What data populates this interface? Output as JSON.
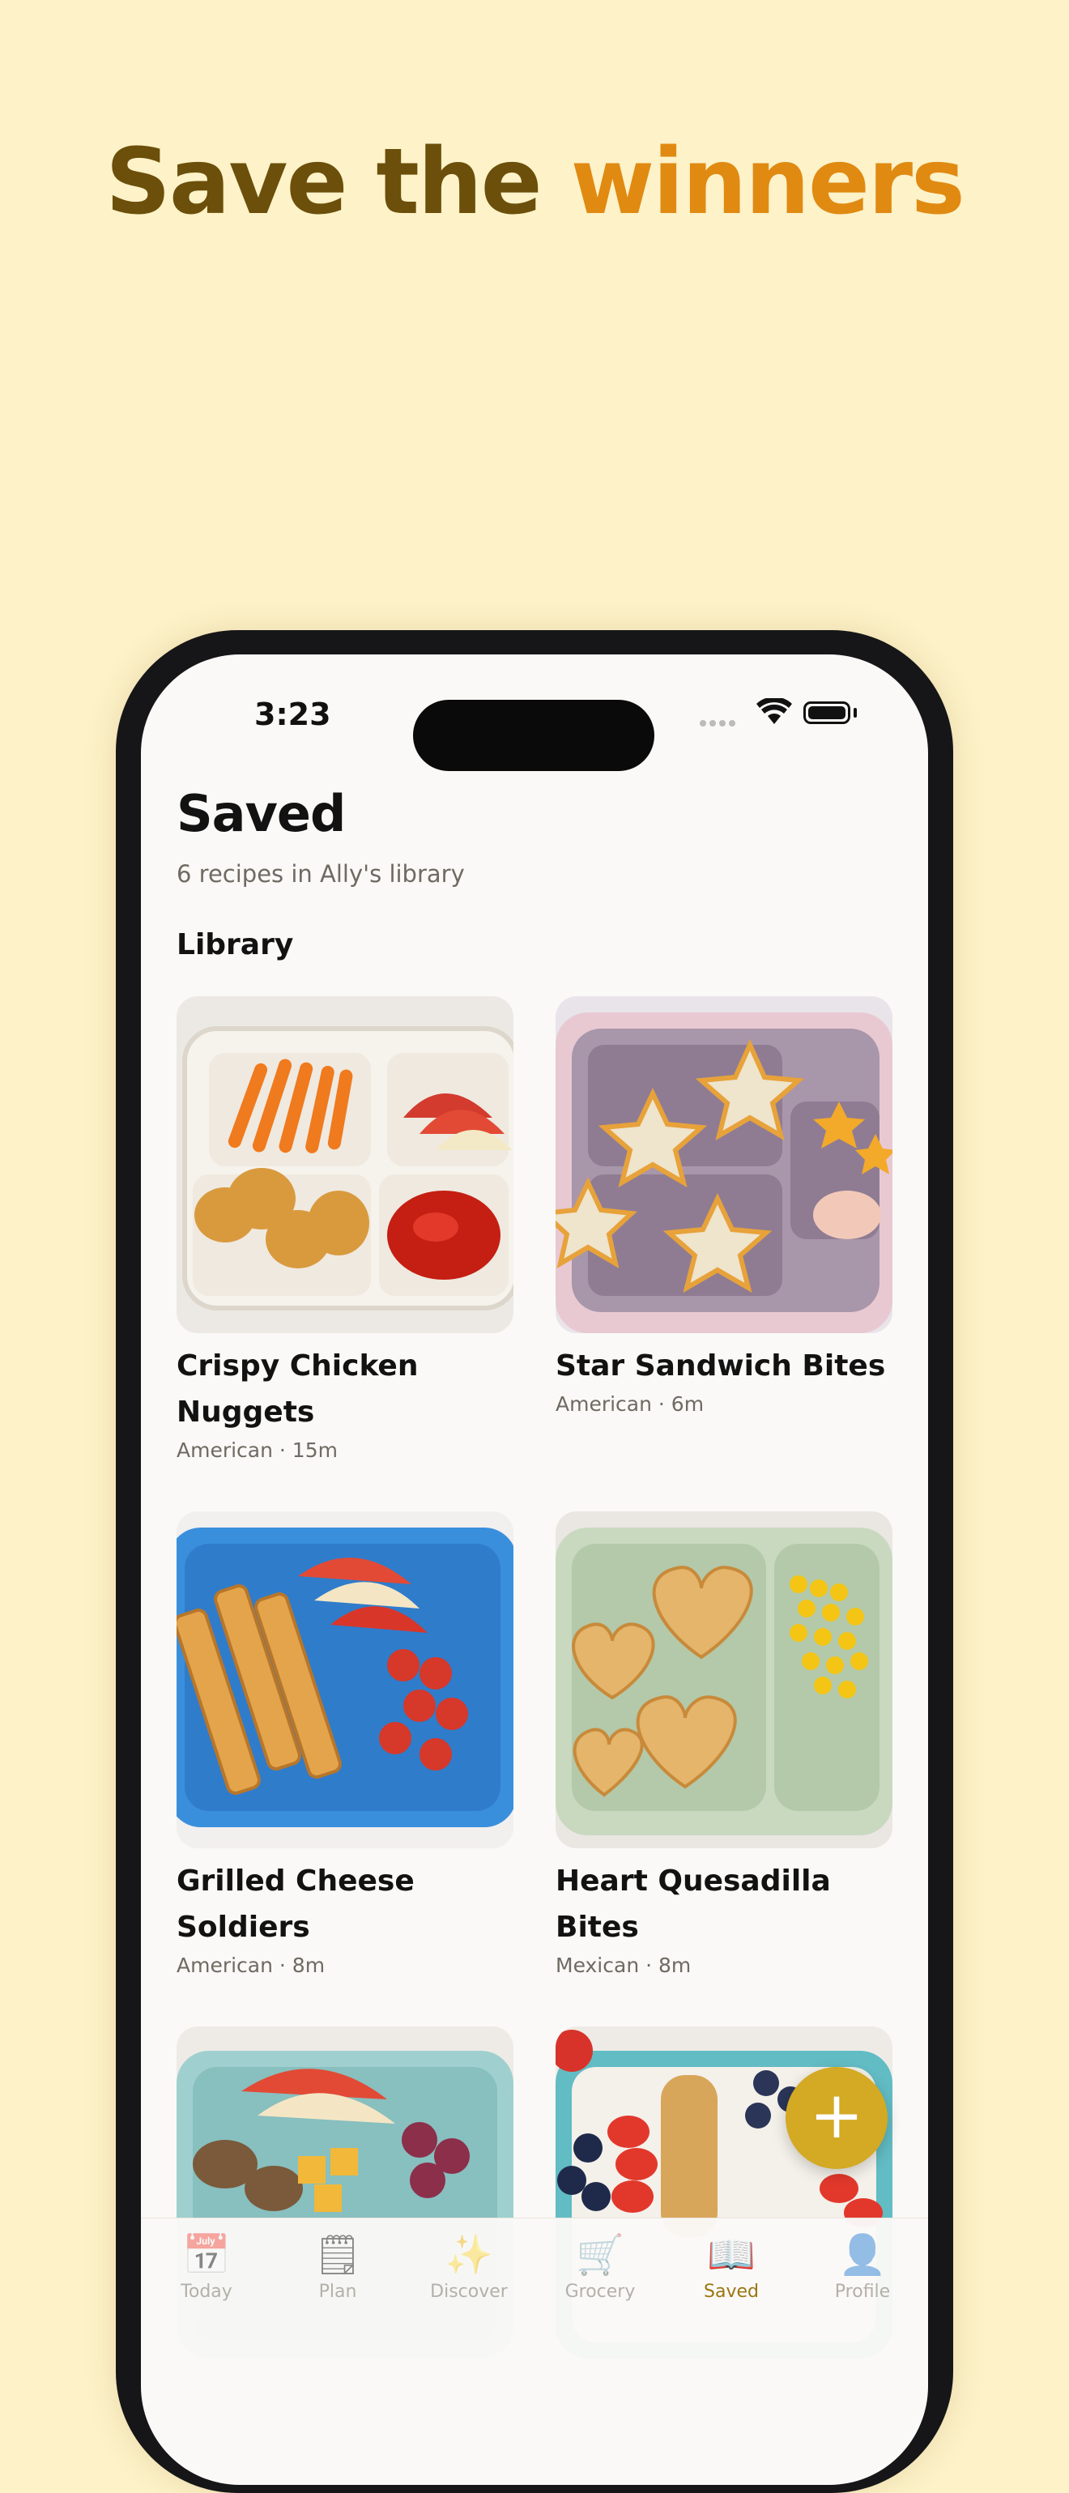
{
  "headline": {
    "part1": "Save the ",
    "part2": "winners"
  },
  "status": {
    "time": "3:23"
  },
  "page": {
    "title": "Saved",
    "subtitle": "6 recipes in Ally's library",
    "section": "Library"
  },
  "recipes": [
    {
      "name": "Crispy Chicken Nuggets",
      "meta": "American · 15m",
      "image": "nuggets-bento"
    },
    {
      "name": "Star Sandwich Bites",
      "meta": "American · 6m",
      "image": "star-sandwich-bento"
    },
    {
      "name": "Grilled Cheese Soldiers",
      "meta": "American · 8m",
      "image": "grilled-cheese-bento"
    },
    {
      "name": "Heart Quesadilla Bites",
      "meta": "Mexican · 8m",
      "image": "heart-quesadilla-bento"
    },
    {
      "name": "",
      "meta": "",
      "image": "apple-chicken-bento"
    },
    {
      "name": "",
      "meta": "",
      "image": "yogurt-berry-bento"
    }
  ],
  "fab": {
    "label": "+"
  },
  "tabs": [
    {
      "label": "Today",
      "icon": "calendar-icon",
      "glyph": "📅"
    },
    {
      "label": "Plan",
      "icon": "notepad-icon",
      "glyph": "🗒"
    },
    {
      "label": "Discover",
      "icon": "sparkles-icon",
      "glyph": "✨"
    },
    {
      "label": "Grocery",
      "icon": "cart-icon",
      "glyph": "🛒"
    },
    {
      "label": "Saved",
      "icon": "book-icon",
      "glyph": "📖"
    },
    {
      "label": "Profile",
      "icon": "person-icon",
      "glyph": "👤"
    }
  ],
  "colors": {
    "background": "#fdf2c8",
    "accent": "#e08a12",
    "brand_dark": "#6b4f0a",
    "fab": "#d4a923",
    "active_tab": "#9a7612"
  }
}
